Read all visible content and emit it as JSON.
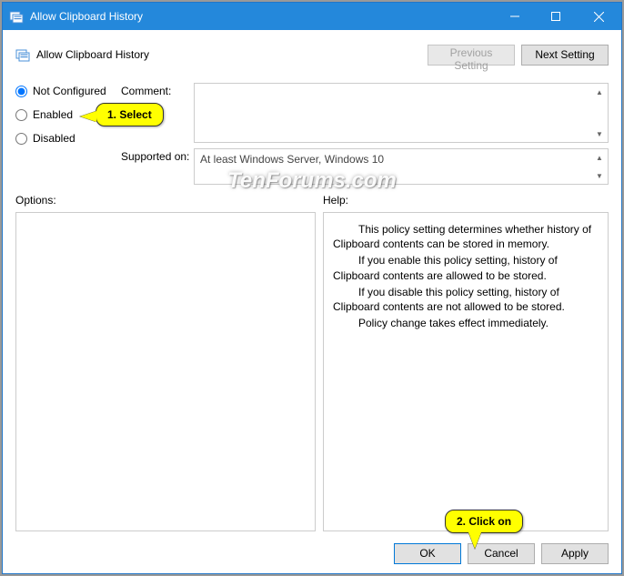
{
  "titlebar": {
    "title": "Allow Clipboard History"
  },
  "header": {
    "title": "Allow Clipboard History",
    "previous": "Previous Setting",
    "next": "Next Setting"
  },
  "radios": {
    "not_configured": "Not Configured",
    "enabled": "Enabled",
    "disabled": "Disabled",
    "selected": "not_configured"
  },
  "labels": {
    "comment": "Comment:",
    "supported": "Supported on:",
    "options": "Options:",
    "help": "Help:"
  },
  "supported_on": "At least Windows Server, Windows 10",
  "help_paragraphs": {
    "p1": "This policy setting determines whether history of Clipboard contents can be stored in memory.",
    "p2": "If you enable this policy setting, history of Clipboard contents are allowed to be stored.",
    "p3": "If you disable this policy setting, history of Clipboard contents are not allowed to be stored.",
    "p4": "Policy change takes effect immediately."
  },
  "buttons": {
    "ok": "OK",
    "cancel": "Cancel",
    "apply": "Apply"
  },
  "callouts": {
    "c1": "1. Select",
    "c2": "2. Click on"
  },
  "watermark": "TenForums.com"
}
